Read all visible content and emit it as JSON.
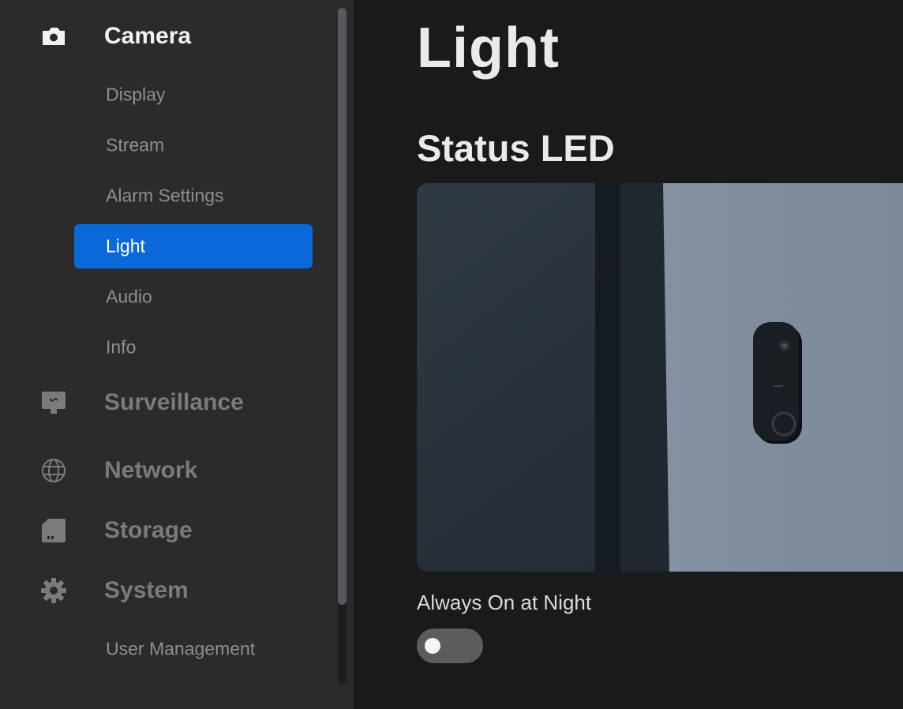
{
  "sidebar": {
    "sections": {
      "camera": {
        "label": "Camera",
        "icon": "camera-icon"
      },
      "surveillance": {
        "label": "Surveillance",
        "icon": "monitor-icon"
      },
      "network": {
        "label": "Network",
        "icon": "globe-icon"
      },
      "storage": {
        "label": "Storage",
        "icon": "sd-card-icon"
      },
      "system": {
        "label": "System",
        "icon": "gear-icon"
      }
    },
    "camera_items": [
      "Display",
      "Stream",
      "Alarm Settings",
      "Light",
      "Audio",
      "Info"
    ],
    "selected_item": "Light",
    "system_items": [
      "User Management"
    ]
  },
  "main": {
    "title": "Light",
    "section_title": "Status LED",
    "setting": {
      "label": "Always On at Night",
      "enabled": false
    }
  },
  "colors": {
    "accent": "#0a68d8",
    "sidebar_bg": "#2b2b2b",
    "main_bg": "#1a1a1a"
  }
}
